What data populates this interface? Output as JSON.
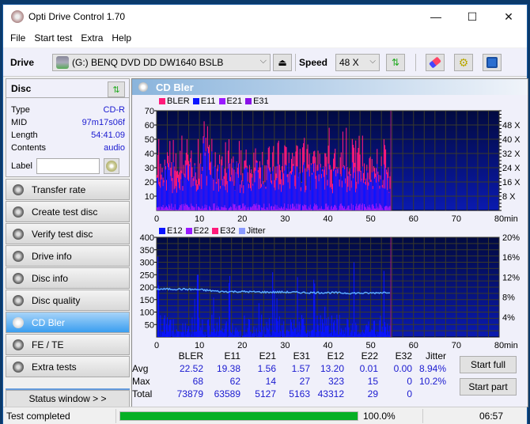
{
  "window": {
    "title": "Opti Drive Control 1.70",
    "minimize": "—",
    "maximize": "☐",
    "close": "✕"
  },
  "menu": [
    "File",
    "Start test",
    "Extra",
    "Help"
  ],
  "toolbar": {
    "drive_label": "Drive",
    "drive_value": "(G:)   BENQ DVD DD DW1640 BSLB",
    "speed_label": "Speed",
    "speed_value": "48 X",
    "eject_icon": "⏏"
  },
  "disc": {
    "header": "Disc",
    "fields": [
      {
        "key": "Type",
        "value": "CD-R"
      },
      {
        "key": "MID",
        "value": "97m17s06f"
      },
      {
        "key": "Length",
        "value": "54:41.09"
      },
      {
        "key": "Contents",
        "value": "audio"
      }
    ],
    "label_key": "Label",
    "label_value": ""
  },
  "nav": [
    {
      "label": "Transfer rate",
      "active": false
    },
    {
      "label": "Create test disc",
      "active": false
    },
    {
      "label": "Verify test disc",
      "active": false
    },
    {
      "label": "Drive info",
      "active": false
    },
    {
      "label": "Disc info",
      "active": false
    },
    {
      "label": "Disc quality",
      "active": false
    },
    {
      "label": "CD Bler",
      "active": true
    },
    {
      "label": "FE / TE",
      "active": false
    },
    {
      "label": "Extra tests",
      "active": false
    }
  ],
  "status_window_button": "Status window > >",
  "panel": {
    "title": "CD Bler"
  },
  "chart_data": [
    {
      "type": "bar",
      "title": "",
      "legend": [
        {
          "name": "BLER",
          "color": "#ff1a7a"
        },
        {
          "name": "E11",
          "color": "#0a14ff"
        },
        {
          "name": "E21",
          "color": "#9a1aff"
        },
        {
          "name": "E31",
          "color": "#8a10e8"
        }
      ],
      "legend_position": "top-left",
      "xlabel": "min",
      "xlim": [
        0,
        80
      ],
      "xticks": [
        0,
        10,
        20,
        30,
        40,
        50,
        60,
        70,
        80
      ],
      "ylim": [
        0,
        70
      ],
      "yticks": [
        10,
        20,
        30,
        40,
        50,
        60,
        70
      ],
      "y2ticks": [
        "8 X",
        "16 X",
        "24 X",
        "32 X",
        "40 X",
        "48 X"
      ],
      "data_end_min": 54.7,
      "series_summary": {
        "BLER": {
          "typical_range": [
            20,
            45
          ],
          "peak": 68,
          "peak_at_min": 11.5
        },
        "E11": {
          "typical_range": [
            15,
            35
          ],
          "peak": 62
        },
        "E21": {
          "typical_range": [
            0,
            5
          ]
        },
        "E31": {
          "typical_range": [
            0,
            5
          ]
        }
      },
      "grid": true
    },
    {
      "type": "bar",
      "title": "",
      "legend": [
        {
          "name": "E12",
          "color": "#0a14ff"
        },
        {
          "name": "E22",
          "color": "#9a1aff"
        },
        {
          "name": "E32",
          "color": "#ff1a7a"
        },
        {
          "name": "Jitter",
          "color": "#8a9aff"
        }
      ],
      "legend_position": "top-left",
      "xlabel": "min",
      "xlim": [
        0,
        80
      ],
      "xticks": [
        0,
        10,
        20,
        30,
        40,
        50,
        60,
        70,
        80
      ],
      "ylim": [
        0,
        400
      ],
      "yticks": [
        50,
        100,
        150,
        200,
        250,
        300,
        350,
        400
      ],
      "y2ticks": [
        "4%",
        "8%",
        "12%",
        "16%",
        "20%"
      ],
      "data_end_min": 54.7,
      "jitter_percent": {
        "x": [
          0,
          5,
          10,
          15,
          20,
          25,
          30,
          35,
          40,
          45,
          50,
          54.7
        ],
        "y": [
          9.6,
          9.6,
          9.5,
          9.1,
          9.1,
          9.0,
          9.0,
          8.9,
          8.9,
          8.8,
          8.8,
          9.0
        ]
      },
      "e12_peaks": [
        {
          "x": 0.3,
          "y": 323
        },
        {
          "x": 9.5,
          "y": 250
        },
        {
          "x": 17,
          "y": 245
        },
        {
          "x": 27,
          "y": 260
        },
        {
          "x": 32.8,
          "y": 240
        },
        {
          "x": 46,
          "y": 300
        },
        {
          "x": 53,
          "y": 265
        }
      ],
      "grid": true
    }
  ],
  "stats": {
    "columns": [
      "BLER",
      "E11",
      "E21",
      "E31",
      "E12",
      "E22",
      "E32",
      "Jitter"
    ],
    "rows": [
      {
        "label": "Avg",
        "values": [
          "22.52",
          "19.38",
          "1.56",
          "1.57",
          "13.20",
          "0.01",
          "0.00",
          "8.94%"
        ]
      },
      {
        "label": "Max",
        "values": [
          "68",
          "62",
          "14",
          "27",
          "323",
          "15",
          "0",
          "10.2%"
        ]
      },
      {
        "label": "Total",
        "values": [
          "73879",
          "63589",
          "5127",
          "5163",
          "43312",
          "29",
          "0",
          ""
        ]
      }
    ]
  },
  "buttons": {
    "start_full": "Start full",
    "start_part": "Start part"
  },
  "statusbar": {
    "text": "Test completed",
    "progress": 100.0,
    "progress_text": "100.0%",
    "time": "06:57"
  },
  "colors": {
    "accent": "#3a9ef0",
    "progress": "#06b025",
    "value_text": "#1a1ad0"
  }
}
